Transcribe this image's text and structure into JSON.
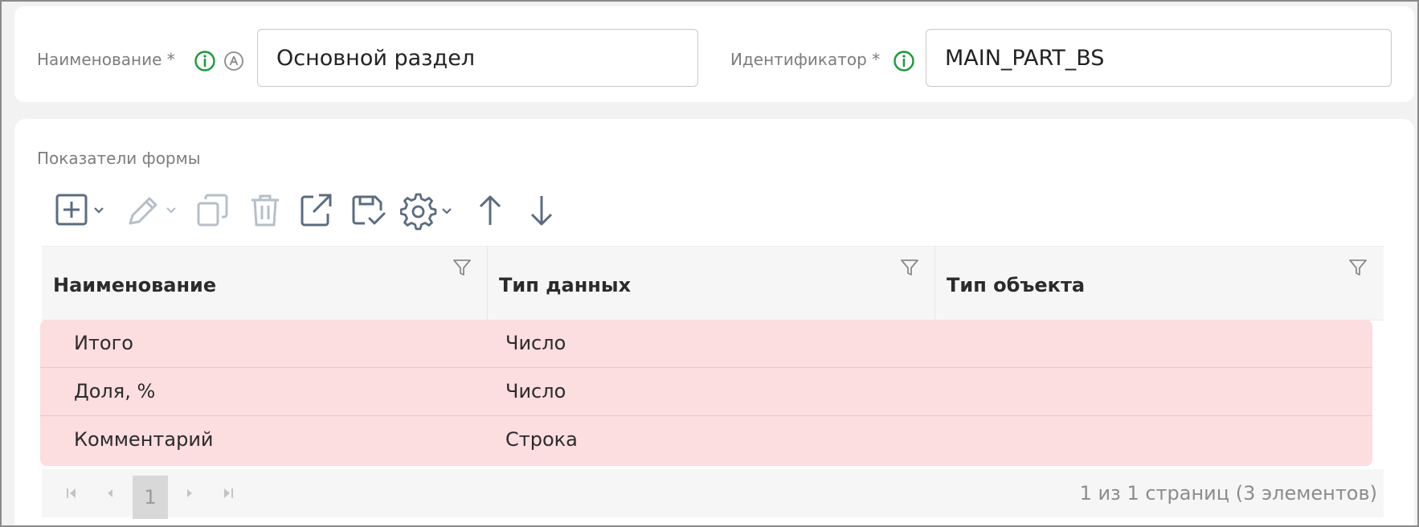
{
  "form": {
    "name_label": "Наименование *",
    "name_value": "Основной раздел",
    "id_label": "Идентификатор *",
    "id_value": "MAIN_PART_BS"
  },
  "section": {
    "title": "Показатели формы"
  },
  "toolbar": {
    "icons": [
      "add-icon",
      "edit-icon",
      "copy-icon",
      "delete-icon",
      "open-external-icon",
      "save-check-icon",
      "settings-icon",
      "arrow-up-icon",
      "arrow-down-icon"
    ]
  },
  "table": {
    "columns": [
      "Наименование",
      "Тип данных",
      "Тип объекта"
    ],
    "rows": [
      {
        "name": "Итого",
        "data_type": "Число",
        "object_type": ""
      },
      {
        "name": "Доля, %",
        "data_type": "Число",
        "object_type": ""
      },
      {
        "name": "Комментарий",
        "data_type": "Строка",
        "object_type": ""
      }
    ],
    "row_highlight_color": "#fcdde0"
  },
  "pager": {
    "current_page": "1",
    "info": "1 из 1 страниц (3 элементов)"
  },
  "colors": {
    "info_icon": "#1a9a3a",
    "toolbar_icon": "#5b6c80",
    "toolbar_icon_disabled": "#b6bfc9"
  }
}
